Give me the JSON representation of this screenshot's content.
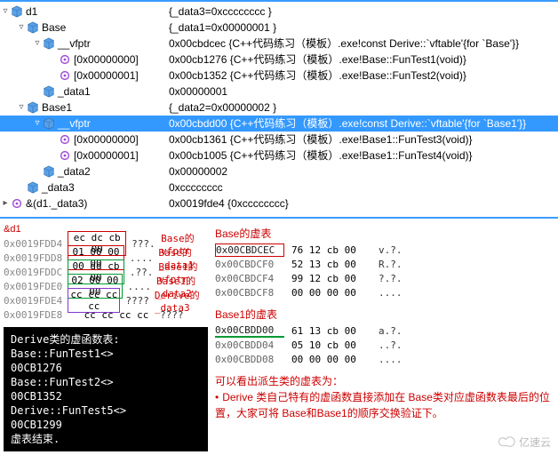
{
  "tree": [
    {
      "indent": 0,
      "arrow": "▿",
      "icon": "cube",
      "name": "d1",
      "value": "{_data3=0xcccccccc }"
    },
    {
      "indent": 1,
      "arrow": "▿",
      "icon": "cube",
      "name": "Base",
      "value": "{_data1=0x00000001 }"
    },
    {
      "indent": 2,
      "arrow": "▿",
      "icon": "cube",
      "name": "__vfptr",
      "value": "0x00cbdcec {C++代码练习（模板）.exe!const Derive::`vftable'{for `Base'}}"
    },
    {
      "indent": 3,
      "arrow": "",
      "icon": "ptr",
      "name": "[0x00000000]",
      "value": "0x00cb1276 {C++代码练习（模板）.exe!Base::FunTest1(void)}"
    },
    {
      "indent": 3,
      "arrow": "",
      "icon": "ptr",
      "name": "[0x00000001]",
      "value": "0x00cb1352 {C++代码练习（模板）.exe!Base::FunTest2(void)}"
    },
    {
      "indent": 2,
      "arrow": "",
      "icon": "cube",
      "name": "_data1",
      "value": "0x00000001"
    },
    {
      "indent": 1,
      "arrow": "▿",
      "icon": "cube",
      "name": "Base1",
      "value": "{_data2=0x00000002 }"
    },
    {
      "indent": 2,
      "arrow": "▿",
      "icon": "cube",
      "name": "__vfptr",
      "value": "0x00cbdd00 {C++代码练习（模板）.exe!const Derive::`vftable'{for `Base1'}}",
      "selected": true
    },
    {
      "indent": 3,
      "arrow": "",
      "icon": "ptr",
      "name": "[0x00000000]",
      "value": "0x00cb1361 {C++代码练习（模板）.exe!Base1::FunTest3(void)}"
    },
    {
      "indent": 3,
      "arrow": "",
      "icon": "ptr",
      "name": "[0x00000001]",
      "value": "0x00cb1005 {C++代码练习（模板）.exe!Base1::FunTest4(void)}"
    },
    {
      "indent": 2,
      "arrow": "",
      "icon": "cube",
      "name": "_data2",
      "value": "0x00000002"
    },
    {
      "indent": 1,
      "arrow": "",
      "icon": "cube",
      "name": "_data3",
      "value": "0xcccccccc"
    },
    {
      "indent": 0,
      "arrow": "▸",
      "icon": "ptr",
      "name": "&(d1._data3)",
      "value": "0x0019fde4 {0xcccccccc}"
    }
  ],
  "addrLabel": "&d1",
  "mem": [
    {
      "addr": "0x0019FDD4",
      "bytes": "ec dc cb 00",
      "border": "b-red",
      "asc": "???.",
      "note": "Base的vfptr"
    },
    {
      "addr": "0x0019FDD8",
      "bytes": "01 00 00 00",
      "border": "b-red",
      "asc": "....",
      "note": "Base的_data1"
    },
    {
      "addr": "0x0019FDDC",
      "bytes": "00 dd cb 00",
      "border": "b-green",
      "asc": ".??.",
      "note": "Base1的vfptr"
    },
    {
      "addr": "0x0019FDE0",
      "bytes": "02 00 00 00",
      "border": "b-green",
      "asc": "....",
      "note": "Base1的_data2"
    },
    {
      "addr": "0x0019FDE4",
      "bytes": "cc cc cc cc",
      "border": "b-purple",
      "asc": "????",
      "note": "Derive的_data3"
    },
    {
      "addr": "0x0019FDE8",
      "bytes": "cc cc cc cc",
      "border": "",
      "asc": "????",
      "note": ""
    }
  ],
  "console": [
    "Derive类的虚函数表:",
    "Base::FunTest1<>",
    "00CB1276",
    "Base::FunTest2<>",
    "00CB1352",
    "Derive::FunTest5<>",
    "00CB1299",
    "虚表结束."
  ],
  "vt1_title": "Base的虚表",
  "vt1": [
    {
      "addr": "0x00CBDCEC",
      "hl": "hl-red",
      "bytes": "76 12 cb 00",
      "asc": "v.?."
    },
    {
      "addr": "0x00CBDCF0",
      "hl": "",
      "bytes": "52 13 cb 00",
      "asc": "R.?."
    },
    {
      "addr": "0x00CBDCF4",
      "hl": "",
      "bytes": "99 12 cb 00",
      "asc": "?.?."
    },
    {
      "addr": "0x00CBDCF8",
      "hl": "",
      "bytes": "00 00 00 00",
      "asc": "...."
    }
  ],
  "vt2_title": "Base1的虚表",
  "vt2": [
    {
      "addr": "0x00CBDD00",
      "hl": "hl-green",
      "bytes": "61 13 cb 00",
      "asc": "a.?."
    },
    {
      "addr": "0x00CBDD04",
      "hl": "",
      "bytes": "05 10 cb 00",
      "asc": "..?."
    },
    {
      "addr": "0x00CBDD08",
      "hl": "",
      "bytes": "00 00 00 00",
      "asc": "...."
    }
  ],
  "notes_title": "可以看出派生类的虚表为：",
  "notes_lines": [
    "Derive 类自己特有的虚函数直接添加在 Base类对应虚函数表最后的位置，大家可将 Base和Base1的顺序交换验证下。"
  ],
  "watermark": "亿速云"
}
